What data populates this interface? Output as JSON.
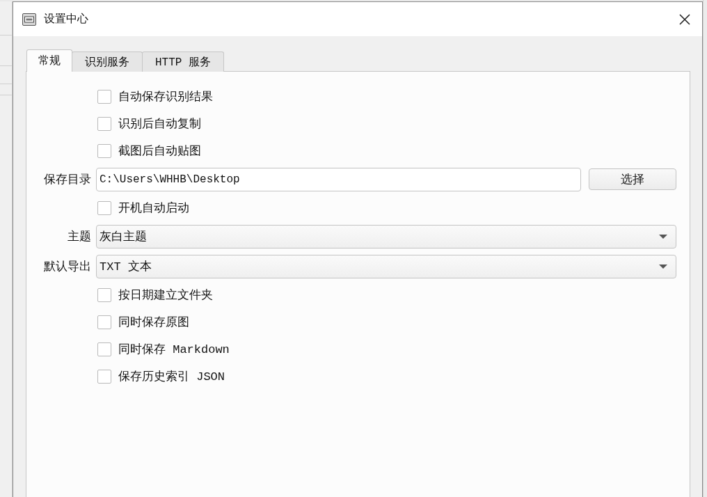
{
  "window": {
    "title": "设置中心"
  },
  "tabs": [
    {
      "label": "常规",
      "selected": true
    },
    {
      "label": "识别服务",
      "selected": false
    },
    {
      "label": "HTTP 服务",
      "selected": false
    }
  ],
  "settings": [
    {
      "kind": "checkbox",
      "label": "自动保存识别结果",
      "checked": false
    },
    {
      "kind": "checkbox",
      "label": "识别后自动复制",
      "checked": false
    },
    {
      "kind": "checkbox",
      "label": "截图后自动贴图",
      "checked": false
    },
    {
      "kind": "path",
      "label": "保存目录",
      "value": "C:\\Users\\WHHB\\Desktop",
      "button": "选择"
    },
    {
      "kind": "checkbox",
      "label": "开机自动启动",
      "checked": false
    },
    {
      "kind": "dropdown",
      "label": "主题",
      "value": "灰白主题"
    },
    {
      "kind": "dropdown",
      "label": "默认导出",
      "value": "TXT 文本"
    },
    {
      "kind": "checkbox",
      "label": "按日期建立文件夹",
      "checked": false
    },
    {
      "kind": "checkbox",
      "label": "同时保存原图",
      "checked": false
    },
    {
      "kind": "checkbox",
      "label": "同时保存 Markdown",
      "checked": false
    },
    {
      "kind": "checkbox",
      "label": "保存历史索引 JSON",
      "checked": false
    }
  ]
}
